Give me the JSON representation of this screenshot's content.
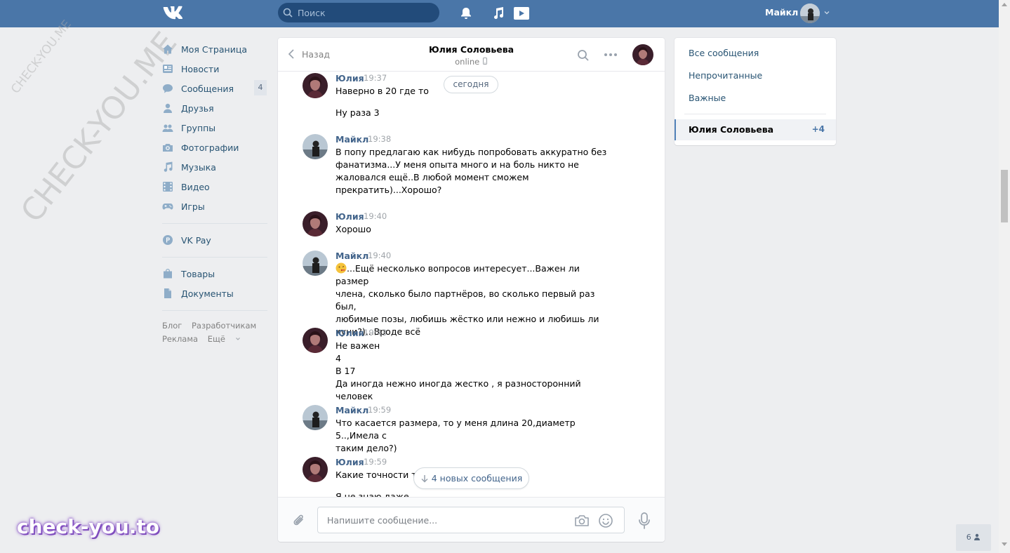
{
  "topbar": {
    "search_placeholder": "Поиск",
    "user_name": "Майкл",
    "brand_color": "#4a76a8"
  },
  "leftnav": {
    "items": [
      {
        "label": "Моя Страница",
        "icon": "home-icon"
      },
      {
        "label": "Новости",
        "icon": "news-icon"
      },
      {
        "label": "Сообщения",
        "icon": "messages-icon",
        "badge": "4"
      },
      {
        "label": "Друзья",
        "icon": "friends-icon"
      },
      {
        "label": "Группы",
        "icon": "groups-icon"
      },
      {
        "label": "Фотографии",
        "icon": "camera-icon"
      },
      {
        "label": "Музыка",
        "icon": "music-icon"
      },
      {
        "label": "Видео",
        "icon": "video-icon"
      },
      {
        "label": "Игры",
        "icon": "gamepad-icon"
      }
    ],
    "vkpay": "VK Pay",
    "items2": [
      {
        "label": "Товары",
        "icon": "bag-icon"
      },
      {
        "label": "Документы",
        "icon": "document-icon"
      }
    ],
    "footer": {
      "blog": "Блог",
      "dev": "Разработчикам",
      "ads": "Реклама",
      "more": "Ещё"
    }
  },
  "chat": {
    "back_label": "Назад",
    "title": "Юлия Соловьева",
    "status": "online",
    "date_pill": "сегодня",
    "new_messages_pill": "4 новых сообщения",
    "input_placeholder": "Напишите сообщение...",
    "messages": [
      {
        "author": "Юлия",
        "time": "19:37",
        "lines": [
          "Наверно в 20 где то",
          "",
          "Ну раза 3"
        ]
      },
      {
        "author": "Майкл",
        "time": "19:38",
        "lines": [
          "В попу предлагаю как нибудь попробовать аккуратно без",
          "фанатизма...У меня опыта много и на боль никто не",
          "жаловался ещё..В любой момент сможем",
          "прекратить)...Хорошо?"
        ]
      },
      {
        "author": "Юлия",
        "time": "19:40",
        "lines": [
          "Хорошо"
        ]
      },
      {
        "author": "Майкл",
        "time": "19:40",
        "lines": [
          "...Ещё несколько вопросов интересует...Важен ли размер",
          "члена, сколько было партнёров, во сколько первый раз был,",
          "любимые позы, любишь жёстко или нежно и любишь ли",
          "куни?)...Вроде всё"
        ]
      },
      {
        "author": "Юлия",
        "time": "19:43",
        "lines": [
          "Не важен",
          "4",
          "В 17",
          "Да иногда нежно иногда жестко , я разносторонний человек"
        ]
      },
      {
        "author": "Майкл",
        "time": "19:59",
        "lines": [
          "Что касается размера, то у меня длина 20,диаметр 5..,Имела с",
          "таким дело?)"
        ]
      },
      {
        "author": "Юлия",
        "time": "19:59",
        "lines": [
          "Какие точности то",
          "",
          "Я не знаю даже"
        ]
      }
    ]
  },
  "filters": {
    "all": "Все сообщения",
    "unread": "Непрочитанные",
    "important": "Важные",
    "active_name": "Юлия Соловьева",
    "active_count": "+4"
  },
  "watermarks": {
    "small": "CHECK-YOU.ME",
    "big": "CHECK-YOU.ME",
    "brand": "check-you.to"
  },
  "online_count": "6"
}
